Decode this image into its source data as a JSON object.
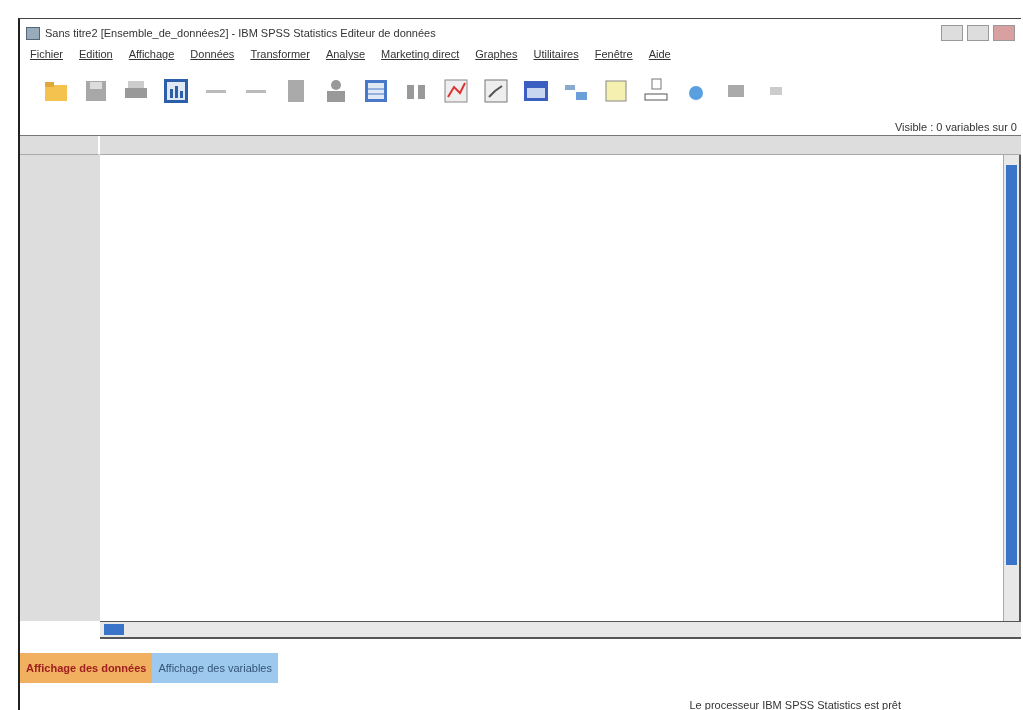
{
  "window": {
    "title": "Sans titre2 [Ensemble_de_données2] - IBM SPSS Statistics Editeur de données"
  },
  "menu": [
    "Fichier",
    "Edition",
    "Affichage",
    "Données",
    "Transformer",
    "Analyse",
    "Marketing direct",
    "Graphes",
    "Utilitaires",
    "Fenêtre",
    "Aide"
  ],
  "visible_info": "Visible : 0 variables sur 0",
  "tabs": [
    {
      "label": "Affichage des données",
      "selected": true
    },
    {
      "label": "Affichage des variables",
      "selected": false
    }
  ],
  "status_bar": "Le processeur IBM SPSS Statistics  est prêt"
}
